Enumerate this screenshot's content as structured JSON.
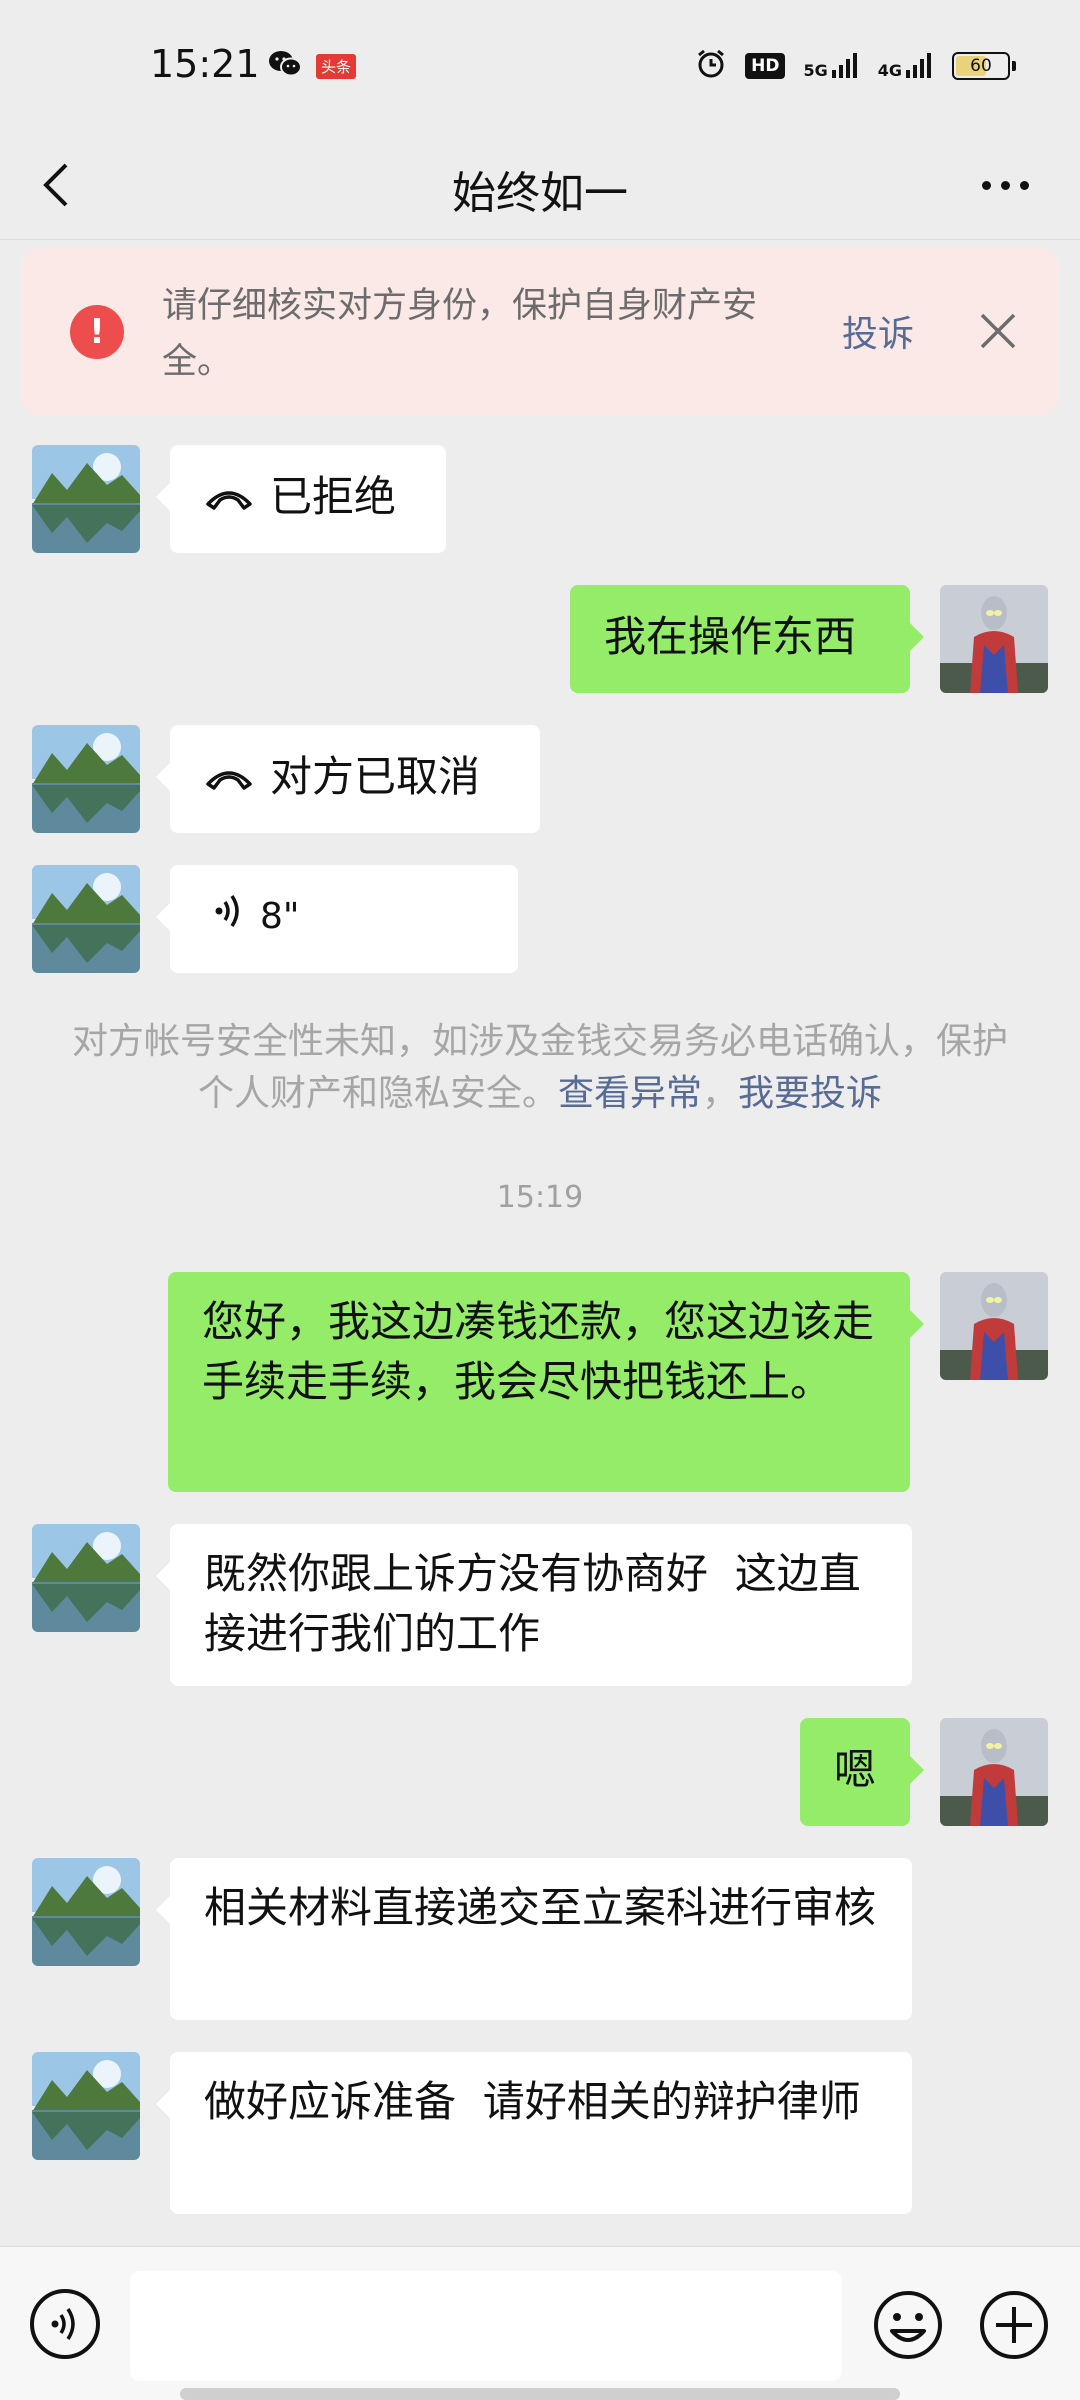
{
  "status_bar": {
    "time": "15:21",
    "app_badge": "头条",
    "hd_label": "HD",
    "net1": "5G",
    "net2": "4G",
    "battery": "60",
    "battery_level_percent": 60
  },
  "header": {
    "title": "始终如一"
  },
  "warning": {
    "text": "请仔细核实对方身份，保护自身财产安全。",
    "complain": "投诉"
  },
  "messages": [
    {
      "side": "left",
      "type": "call",
      "text": "已拒绝"
    },
    {
      "side": "right",
      "type": "text",
      "text": "我在操作东西"
    },
    {
      "side": "left",
      "type": "call",
      "text": "对方已取消"
    },
    {
      "side": "left",
      "type": "voice",
      "text": "8\""
    },
    {
      "side": "right",
      "type": "text",
      "text": "您好，我这边凑钱还款，您这边该走手续走手续，我会尽快把钱还上。"
    },
    {
      "side": "left",
      "type": "text",
      "text": "既然你跟上诉方没有协商好  这边直接进行我们的工作"
    },
    {
      "side": "right",
      "type": "text",
      "text": "嗯"
    },
    {
      "side": "left",
      "type": "text",
      "text": "相关材料直接递交至立案科进行审核"
    },
    {
      "side": "left",
      "type": "text",
      "text": "做好应诉准备  请好相关的辩护律师"
    }
  ],
  "system_notice": {
    "text": "对方帐号安全性未知，如涉及金钱交易务必电话确认，保护个人财产和隐私安全。",
    "link_view": "查看异常",
    "separator": "，",
    "link_report": "我要投诉"
  },
  "timestamp": "15:19",
  "input": {
    "placeholder": ""
  },
  "colors": {
    "green_bubble": "#95ec69",
    "link": "#576b95",
    "warning_bg": "#fbe9e8",
    "warning_icon": "#ee4d4d"
  }
}
